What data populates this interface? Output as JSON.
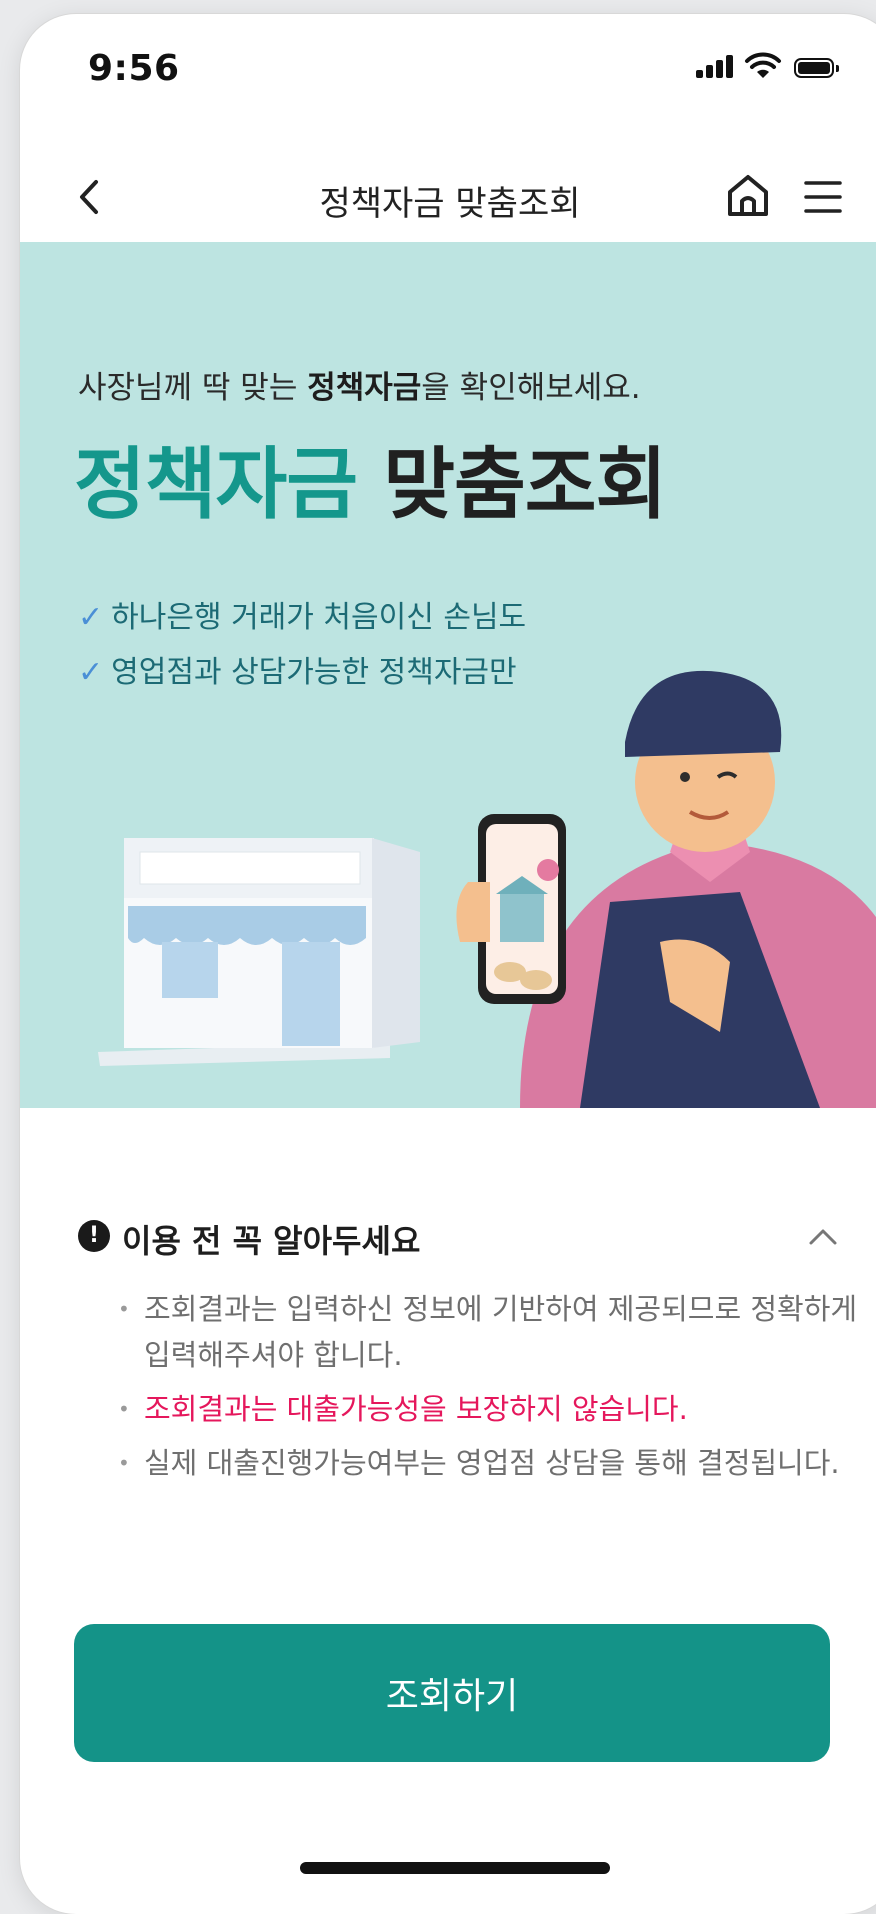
{
  "status_bar": {
    "time": "9:56"
  },
  "header": {
    "title": "정책자금 맞춤조회"
  },
  "hero": {
    "subtitle_pre": "사장님께 딱 맞는 ",
    "subtitle_bold": "정책자금",
    "subtitle_post": "을 확인해보세요.",
    "title_highlight": "정책자금",
    "title_rest": " 맞춤조회",
    "checks": [
      "하나은행 거래가 처음이신 손님도",
      "영업점과 상담가능한 정책자금만"
    ]
  },
  "notice": {
    "title": "이용 전 꼭 알아두세요",
    "items": [
      "조회결과는 입력하신 정보에 기반하여 제공되므로 정확하게 입력해주셔야 합니다.",
      "조회결과는 대출가능성을 보장하지 않습니다.",
      "실제 대출진행가능여부는 영업점 상담을 통해 결정됩니다."
    ]
  },
  "cta": {
    "label": "조회하기"
  },
  "colors": {
    "accent": "#149388",
    "hero_bg": "#bde4e1",
    "warning_red": "#e5175c"
  }
}
